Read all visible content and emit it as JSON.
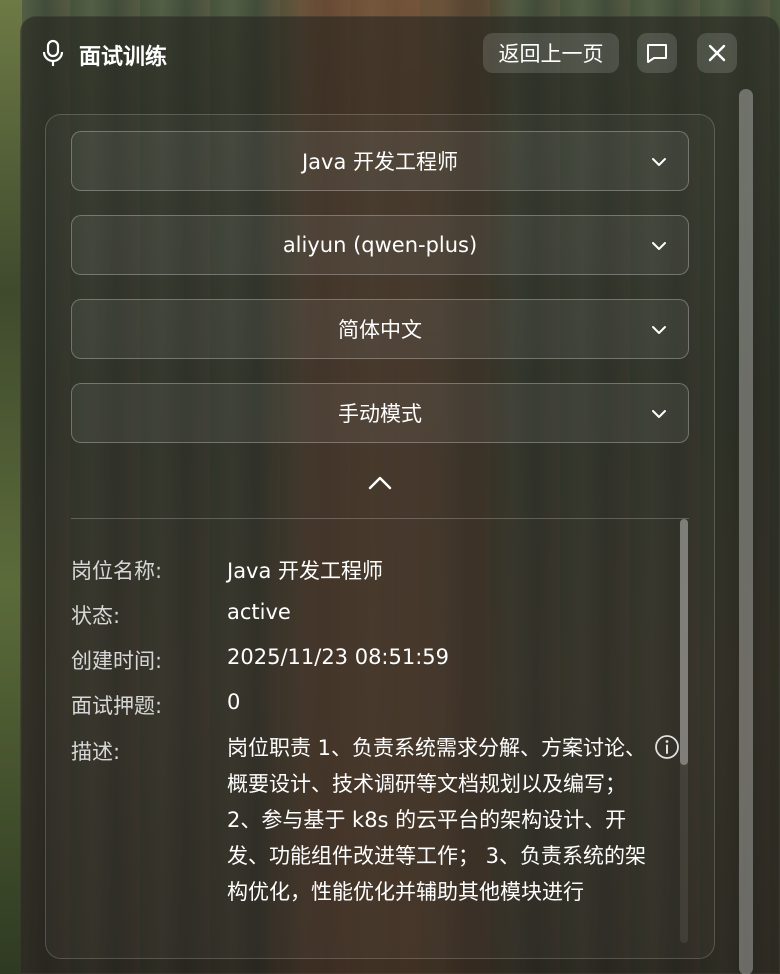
{
  "window": {
    "title": "面试训练",
    "back_label": "返回上一页"
  },
  "selects": [
    {
      "value": "Java 开发工程师"
    },
    {
      "value": "aliyun (qwen-plus)"
    },
    {
      "value": "简体中文"
    },
    {
      "value": "手动模式"
    }
  ],
  "details": {
    "position_label": "岗位名称:",
    "position_value": "Java 开发工程师",
    "status_label": "状态:",
    "status_value": "active",
    "created_label": "创建时间:",
    "created_value": "2025/11/23 08:51:59",
    "questions_label": "面试押题:",
    "questions_value": "0",
    "desc_label": "描述:",
    "desc_value": "岗位职责 1、负责系统需求分解、方案讨论、概要设计、技术调研等文档规划以及编写； 2、参与基于 k8s 的云平台的架构设计、开发、功能组件改进等工作； 3、负责系统的架构优化，性能优化并辅助其他模块进行"
  },
  "icons": {
    "mic": "microphone-icon",
    "chat": "chat-bubble-icon",
    "close": "close-icon",
    "chevron": "chevron-down-icon",
    "collapse": "chevron-up-icon",
    "info": "info-icon"
  },
  "colors": {
    "text": "#ffffff",
    "label": "#d7d7d7"
  }
}
